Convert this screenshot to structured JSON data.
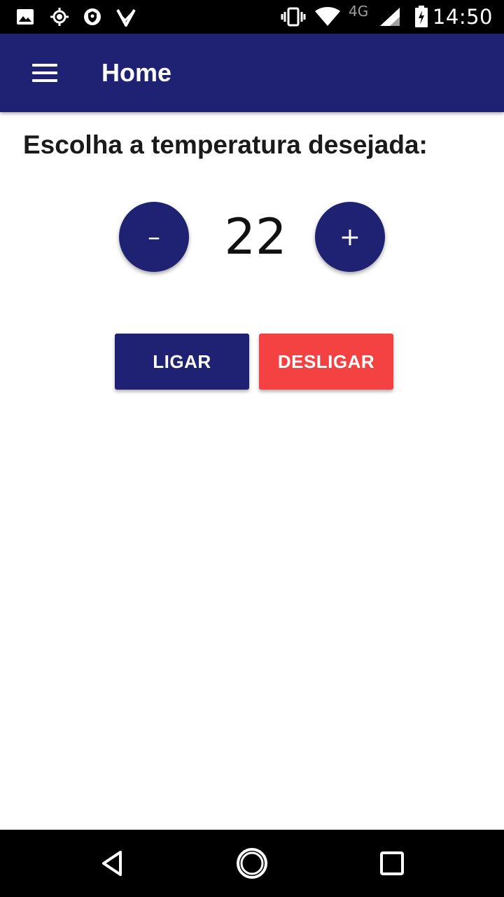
{
  "status_bar": {
    "icons": [
      "image-icon",
      "location-icon",
      "shield-icon",
      "check-icon",
      "vibrate-icon",
      "wifi-icon",
      "signal-icon",
      "battery-icon"
    ],
    "network": "4G",
    "time": "14:50"
  },
  "app_bar": {
    "menu_icon": "menu-icon",
    "title": "Home",
    "color": "#1f2173"
  },
  "thermostat": {
    "prompt": "Escolha a temperatura desejada:",
    "decrement_label": "–",
    "increment_label": "+",
    "value": "22"
  },
  "actions": {
    "on_label": "LIGAR",
    "off_label": "DESLIGAR",
    "on_color": "#1f2173",
    "off_color": "#f44142"
  },
  "nav_bar": {
    "icons": [
      "back-icon",
      "home-icon",
      "recents-icon"
    ]
  }
}
